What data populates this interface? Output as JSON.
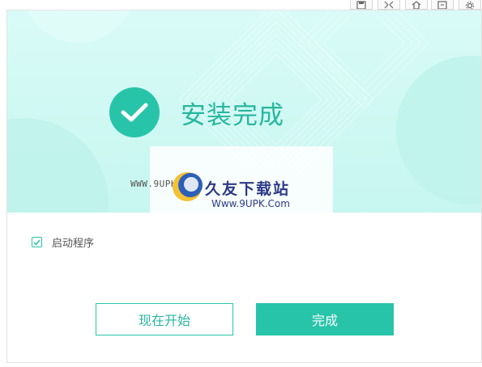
{
  "installer": {
    "title": "安装完成",
    "launch_option_label": "启动程序",
    "launch_option_checked": true,
    "start_now_button": "现在开始",
    "finish_button": "完成"
  },
  "watermark": {
    "url_text": "WWW.9UPK.COM",
    "brand_name": "久友下载站",
    "brand_site": "Www.9UPK.Com"
  },
  "toolbar": {
    "icons": [
      "save-icon",
      "fullscreen-icon",
      "home-icon",
      "window-icon",
      "settings-icon"
    ]
  },
  "colors": {
    "accent": "#27c4aa",
    "hero_bg": "#d9fbf7",
    "title_text": "#27b79e",
    "watermark_brand": "#2d3a87"
  }
}
